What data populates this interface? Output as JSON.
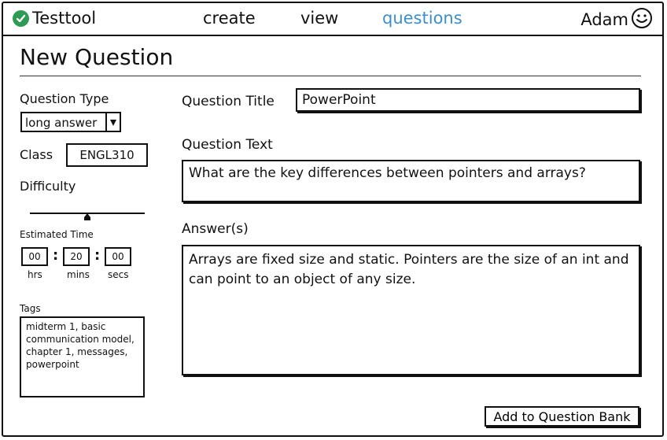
{
  "app": {
    "name": "Testtool",
    "user": "Adam"
  },
  "nav": {
    "create": "create",
    "view": "view",
    "questions": "questions",
    "active": "questions"
  },
  "page": {
    "title": "New Question"
  },
  "left": {
    "question_type_label": "Question Type",
    "question_type_value": "long answer",
    "class_label": "Class",
    "class_value": "ENGL310",
    "difficulty_label": "Difficulty",
    "difficulty_level": 0.5,
    "estimated_time_label": "Estimated Time",
    "time": {
      "hrs": "00",
      "mins": "20",
      "secs": "00"
    },
    "time_units": {
      "hrs": "hrs",
      "mins": "mins",
      "secs": "secs"
    },
    "tags_label": "Tags",
    "tags_value": "midterm 1, basic communication model, chapter 1, messages, powerpoint"
  },
  "right": {
    "question_title_label": "Question Title",
    "question_title_value": "PowerPoint",
    "question_text_label": "Question Text",
    "question_text_value": "What are the key differences between pointers and arrays?",
    "answers_label": "Answer(s)",
    "answers_value": "Arrays are fixed size and static. Pointers are the size of an int and can point to an object of any size."
  },
  "actions": {
    "add_button": "Add to Question Bank"
  },
  "colors": {
    "active_nav": "#3d8fc9",
    "logo_check": "#2e9b54"
  }
}
